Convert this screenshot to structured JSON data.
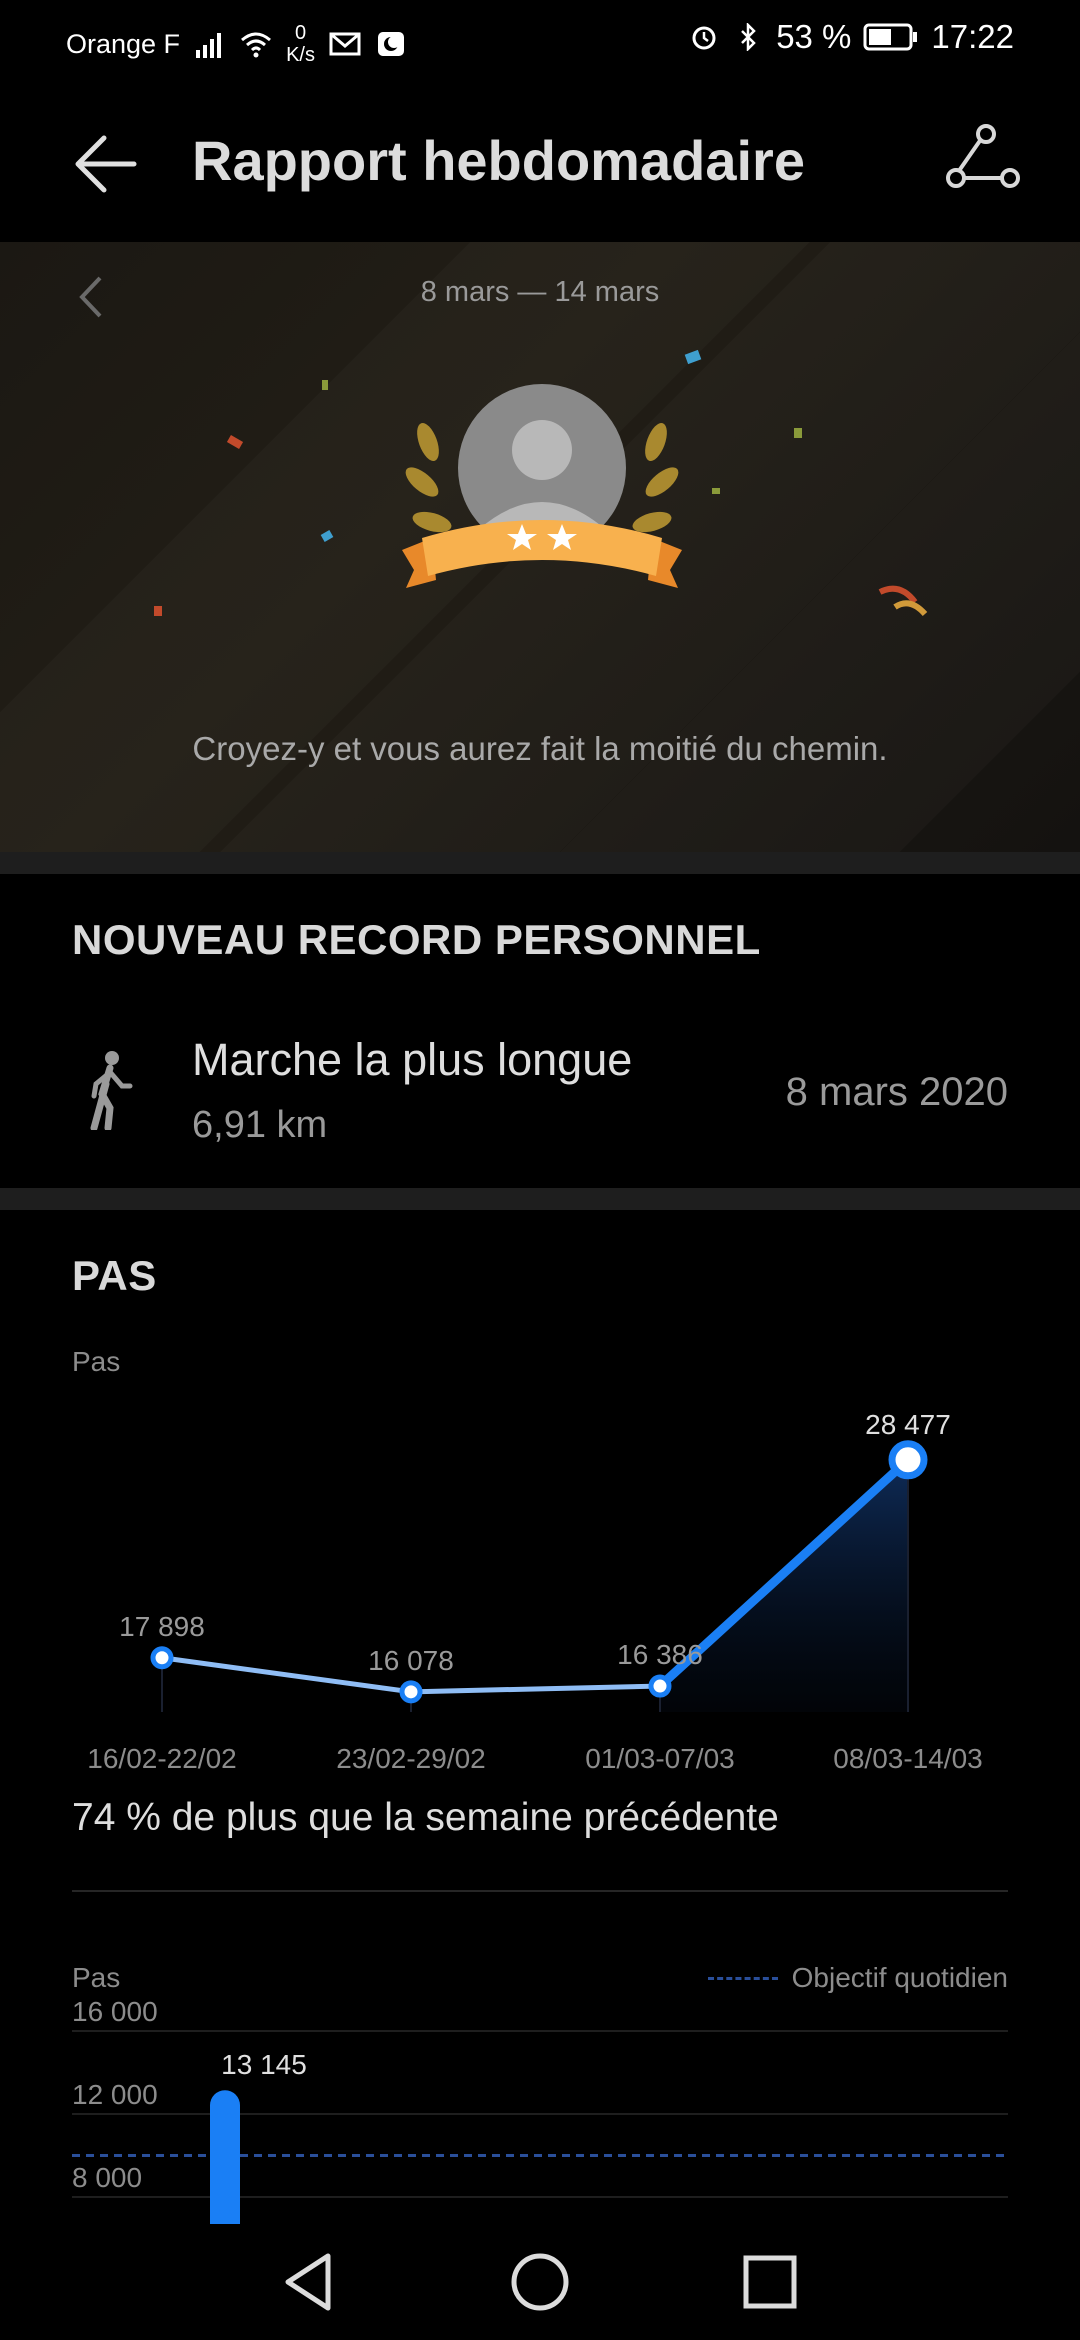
{
  "status_bar": {
    "carrier": "Orange F",
    "net_speed_value": "0",
    "net_speed_unit": "K/s",
    "battery": "53 %",
    "time": "17:22"
  },
  "app_bar": {
    "title": "Rapport hebdomadaire",
    "back_icon": "arrow-left-icon",
    "share_icon": "share-icon"
  },
  "hero": {
    "date_range": "8 mars — 14 mars",
    "stars": 2,
    "quote": "Croyez-y et vous aurez fait la moitié du chemin."
  },
  "record": {
    "section_title": "NOUVEAU RECORD PERSONNEL",
    "name": "Marche la plus longue",
    "value": "6,91 km",
    "date": "8 mars 2020",
    "icon": "walking-person-icon"
  },
  "steps": {
    "section_title": "PAS",
    "y_label": "Pas",
    "comparison": "74 % de plus que la semaine précédente"
  },
  "daily": {
    "y_label": "Pas",
    "legend": "Objectif quotidien"
  },
  "colors": {
    "accent": "#1a7ff5",
    "line_light": "#8fbdf5",
    "goal_line": "#2a4f9a"
  },
  "chart_data": [
    {
      "type": "line",
      "ylabel": "Pas",
      "categories": [
        "16/02-22/02",
        "23/02-29/02",
        "01/03-07/03",
        "08/03-14/03"
      ],
      "values": [
        17898,
        16078,
        16386,
        28477
      ],
      "labels": [
        "17 898",
        "16 078",
        "16 386",
        "28 477"
      ]
    },
    {
      "type": "bar",
      "ylabel": "Pas",
      "yticks": [
        "8 000",
        "12 000",
        "16 000"
      ],
      "ytick_values": [
        8000,
        12000,
        16000
      ],
      "goal": 10000,
      "legend": "Objectif quotidien",
      "values": [
        13145
      ],
      "labels": [
        "13 145"
      ]
    }
  ]
}
